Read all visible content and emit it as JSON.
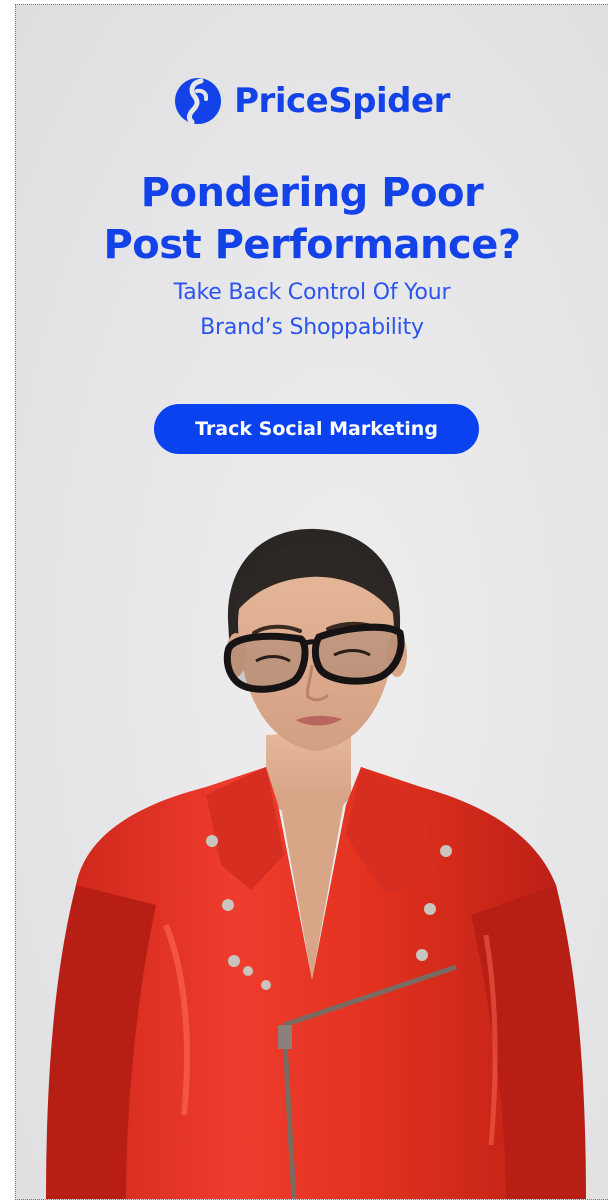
{
  "brand": {
    "name": "PriceSpider",
    "logo_icon": "pricespider-logo-icon",
    "color": "#1242e8"
  },
  "headline": {
    "line1": "Pondering Poor",
    "line2": "Post Performance?"
  },
  "subheadline": {
    "line1": "Take Back Control Of Your",
    "line2": "Brand’s Shoppability"
  },
  "cta": {
    "label": "Track Social Marketing",
    "color": "#0a42f0"
  },
  "colors": {
    "background": "#e6e6e8",
    "jacket": "#e8362b"
  }
}
